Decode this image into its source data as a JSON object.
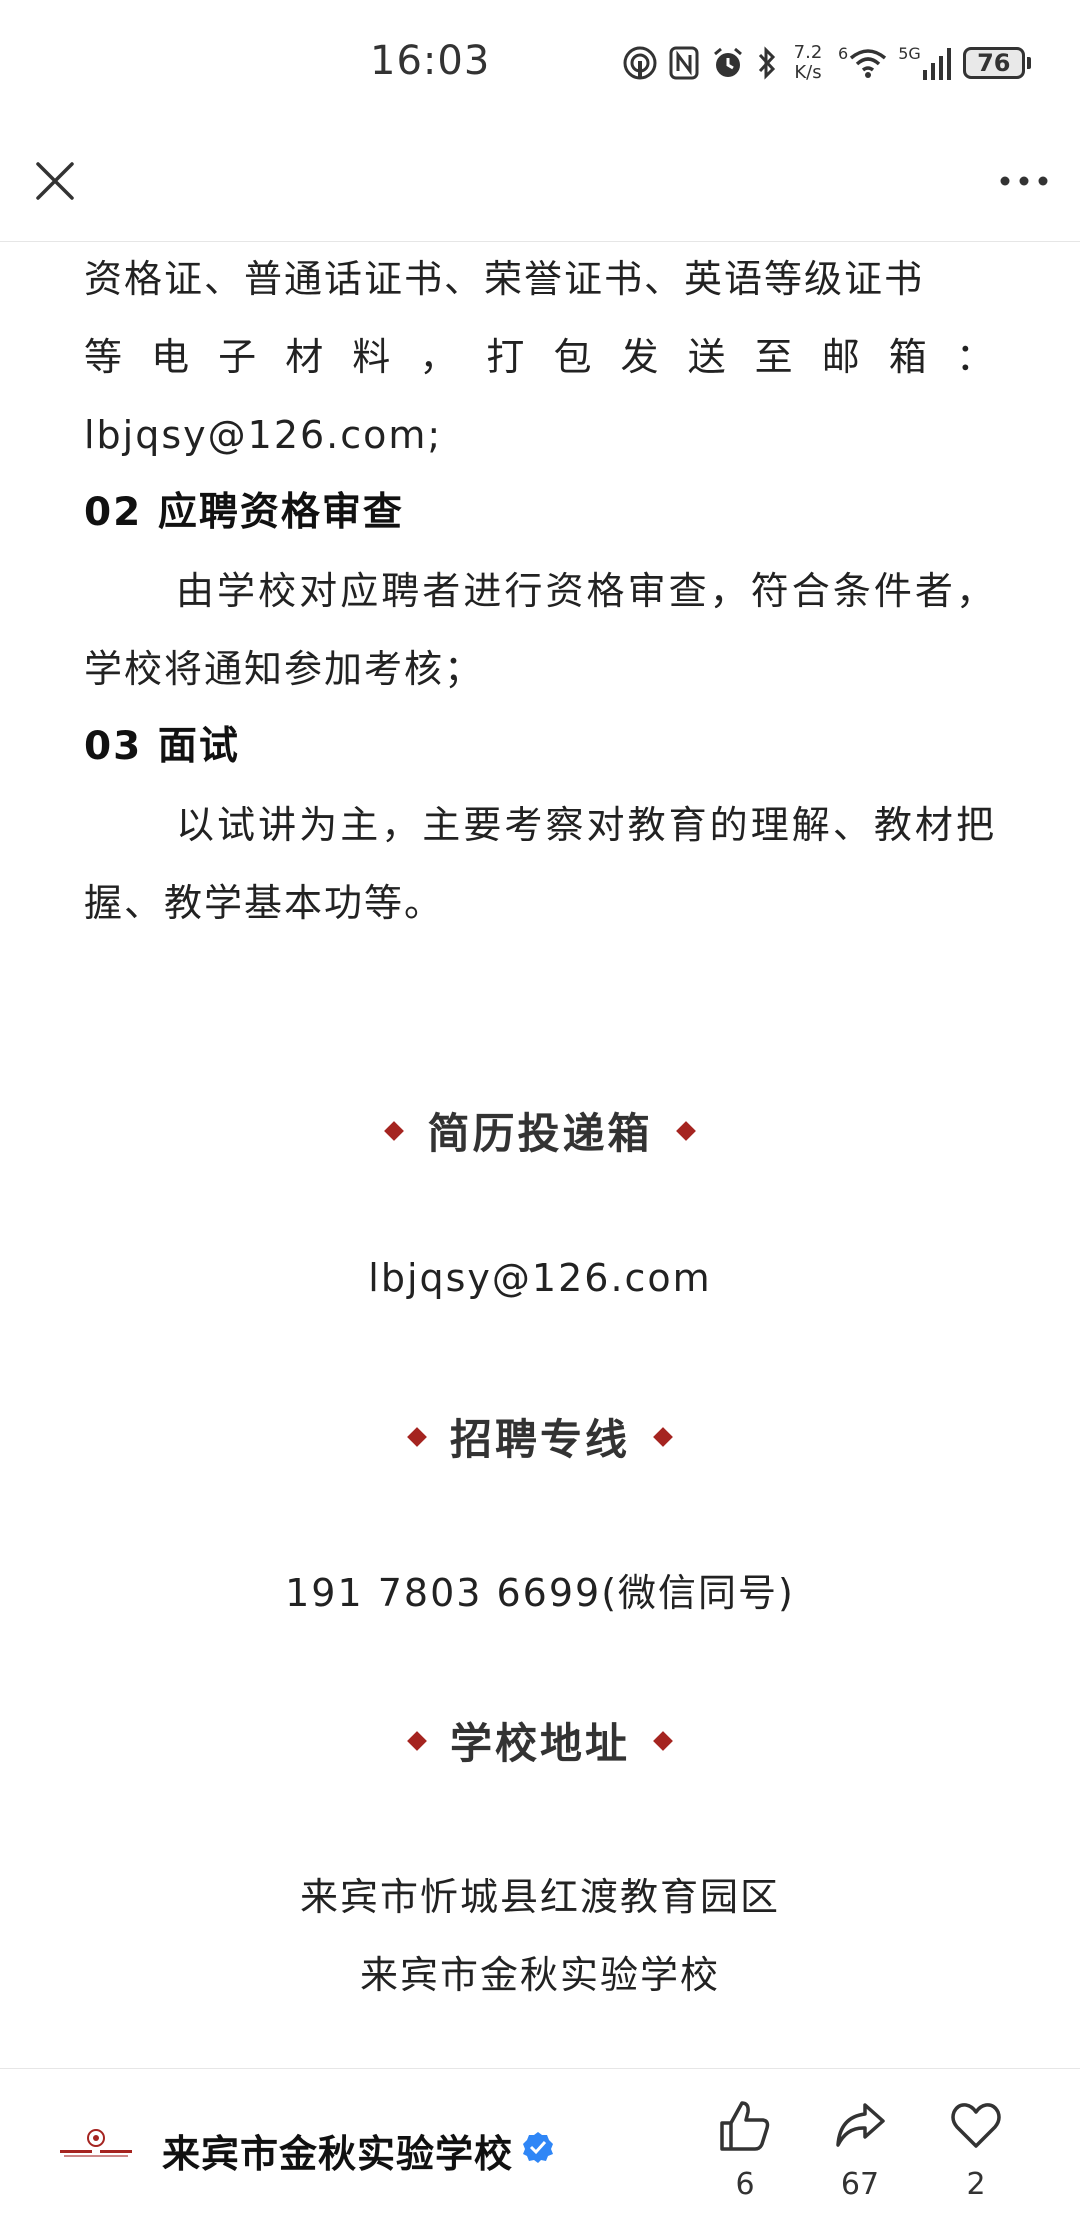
{
  "status_bar": {
    "time": "16:03",
    "speed_top": "7.2",
    "speed_bottom": "K/s",
    "wifi_label": "6",
    "network_label": "5G",
    "battery": "76"
  },
  "article": {
    "line1": "资格证、普通话证书、荣誉证书、英语等级证书",
    "line2_chars": [
      "等",
      "电",
      "子",
      "材",
      "料",
      "，",
      "打",
      "包",
      "发",
      "送",
      "至",
      "邮",
      "箱",
      "："
    ],
    "line3": "lbjqsy@126.com;",
    "heading2": "02 应聘资格审查",
    "para2": "由学校对应聘者进行资格审查，符合条件者，学校将通知参加考核；",
    "heading3": "03 面试",
    "para3": "以试讲为主，主要考察对教育的理解、教材把握、教学基本功等。"
  },
  "resume_box": {
    "title": "简历投递箱",
    "email": "lbjqsy@126.com"
  },
  "hotline": {
    "title": "招聘专线",
    "phone": "191 7803 6699(微信同号)"
  },
  "address": {
    "title": "学校地址",
    "line1": "来宾市忻城县红渡教育园区",
    "line2": "来宾市金秋实验学校"
  },
  "bottom_bar": {
    "account_name": "来宾市金秋实验学校",
    "likes": "6",
    "shares": "67",
    "favorites": "2"
  },
  "colors": {
    "accent_red": "#a52420",
    "verified_blue": "#2f86f6"
  },
  "icons": [
    "nfc-icon",
    "alarm-icon",
    "bluetooth-icon",
    "wifi-icon",
    "signal-icon",
    "battery-icon",
    "close-icon",
    "more-icon",
    "verified-icon",
    "thumbs-up-icon",
    "share-icon",
    "heart-icon"
  ]
}
